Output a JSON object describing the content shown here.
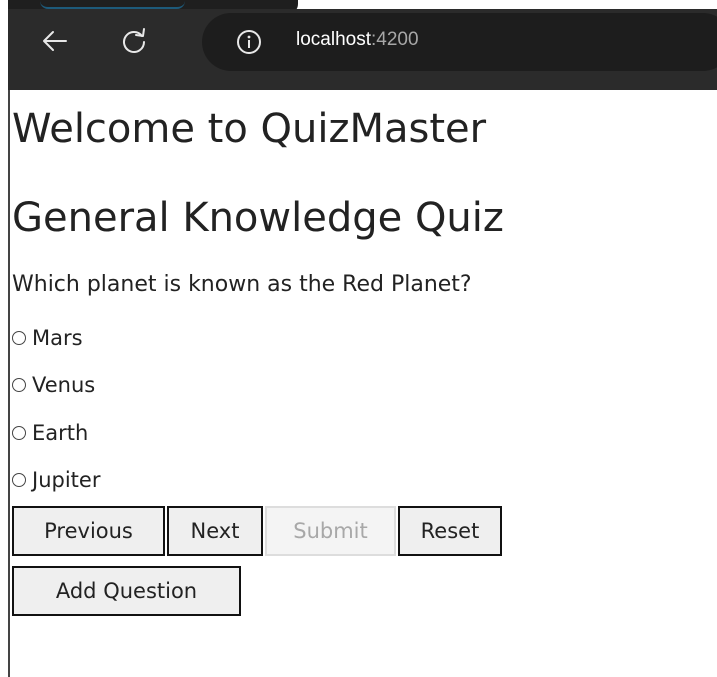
{
  "browser": {
    "url_host": "localhost",
    "url_port": ":4200",
    "icons": [
      "back-arrow-icon",
      "reload-icon",
      "info-icon"
    ]
  },
  "page": {
    "title": "Welcome to QuizMaster",
    "quiz_title": "General Knowledge Quiz",
    "question": "Which planet is known as the Red Planet?",
    "options": [
      "Mars",
      "Venus",
      "Earth",
      "Jupiter"
    ],
    "buttons": {
      "previous": "Previous",
      "next": "Next",
      "submit": "Submit",
      "reset": "Reset",
      "add_question": "Add Question"
    }
  }
}
